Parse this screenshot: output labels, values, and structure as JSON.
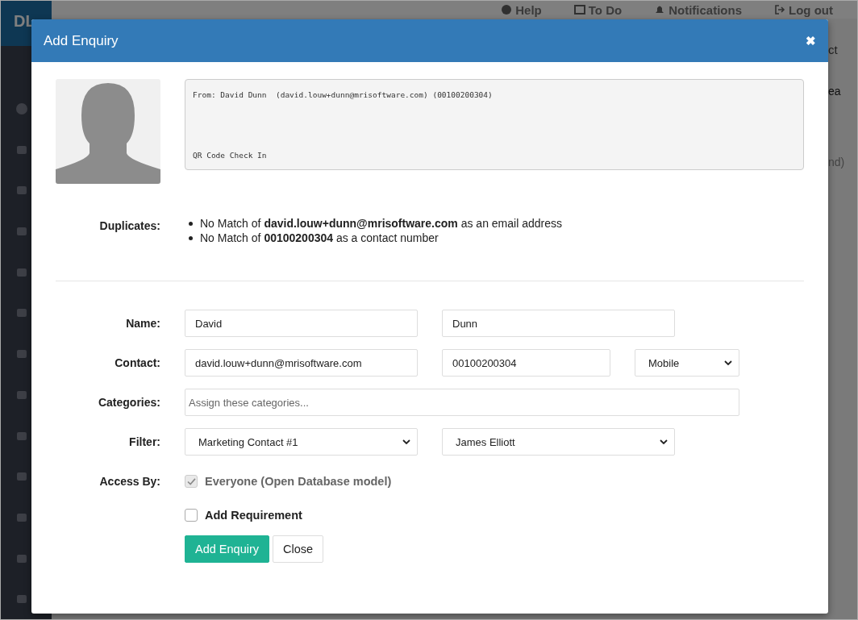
{
  "topbar": {
    "logo": "DL",
    "links": [
      {
        "label": "Help"
      },
      {
        "label": "To Do"
      },
      {
        "label": "Notifications"
      },
      {
        "label": "Log out"
      }
    ]
  },
  "background_fragments": [
    "ct",
    "ea",
    "nd)"
  ],
  "modal": {
    "title": "Add Enquiry",
    "close": "✖",
    "message": [
      "From: David Dunn  (david.louw+dunn@mrisoftware.com) (00100200304)",
      "QR Code Check In"
    ],
    "duplicates": {
      "label": "Duplicates:",
      "items": [
        "No Match of **david.louw+dunn@mrisoftware.com** as an email address",
        "No Match of **00100200304** as a contact number"
      ]
    },
    "name": {
      "label": "Name:",
      "first": "David",
      "last": "Dunn"
    },
    "contact": {
      "label": "Contact:",
      "email": "david.louw+dunn@mrisoftware.com",
      "phone": "00100200304",
      "type": "Mobile"
    },
    "categories": {
      "label": "Categories:",
      "placeholder": "Assign these categories..."
    },
    "filter": {
      "label": "Filter:",
      "first": "Marketing Contact #1",
      "second": "James Elliott"
    },
    "access": {
      "label": "Access By:",
      "option": "Everyone (Open Database model)",
      "checked": true,
      "disabled": true
    },
    "requirement": {
      "label": "Add Requirement",
      "checked": false,
      "disabled": false
    },
    "buttons": [
      {
        "label": "Add Enquiry",
        "kind": "primary"
      },
      {
        "label": "Close",
        "kind": "default"
      }
    ]
  }
}
